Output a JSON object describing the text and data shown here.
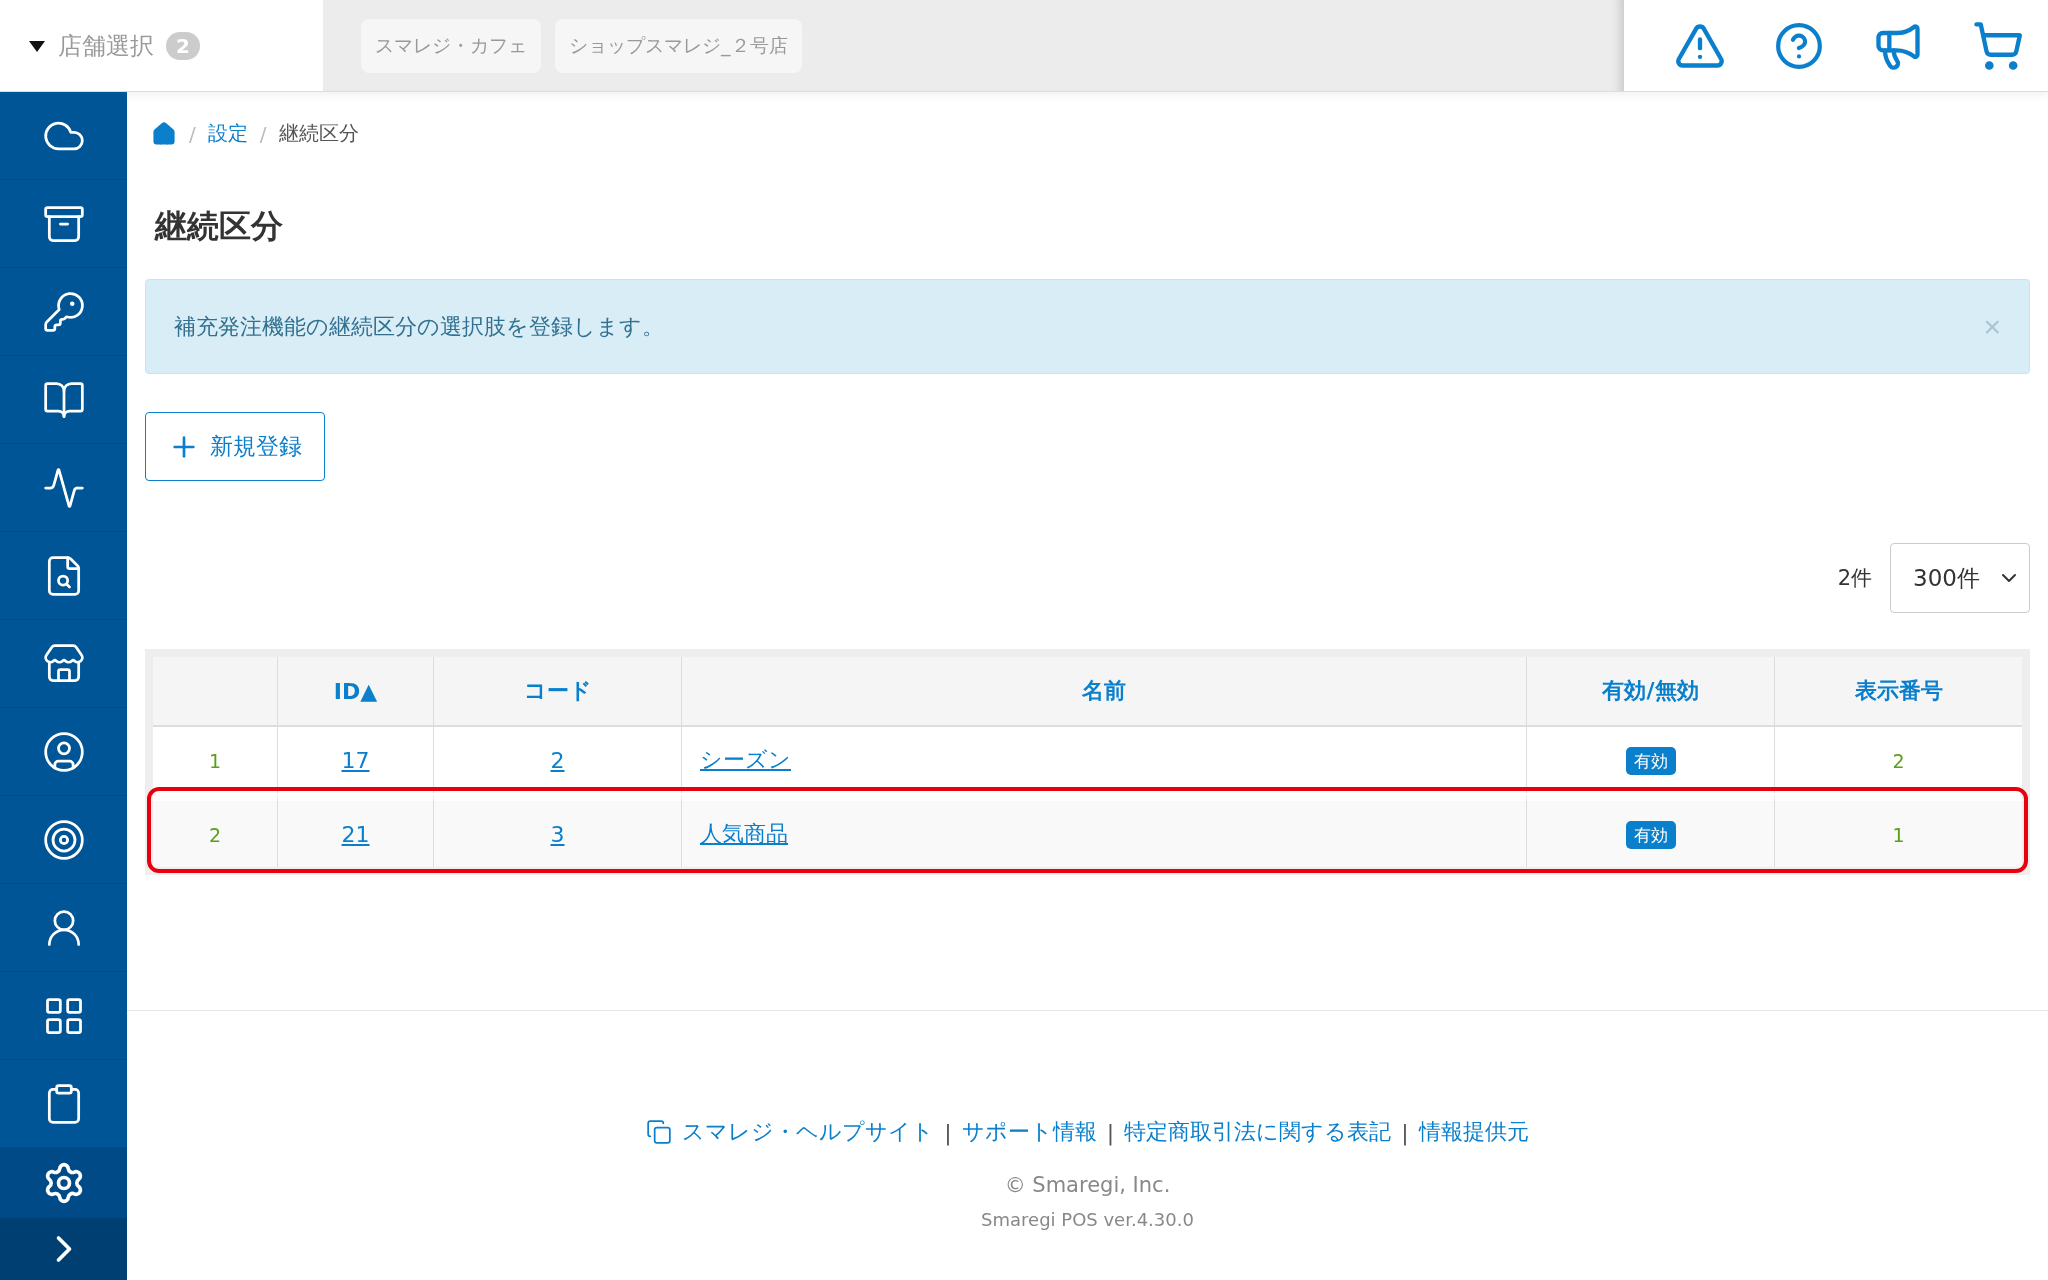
{
  "header": {
    "store_selector": {
      "label": "店舗選択",
      "count": "2",
      "expanded": true
    },
    "stores": [
      {
        "label": "スマレジ・カフェ"
      },
      {
        "label": "ショップスマレジ_２号店"
      }
    ]
  },
  "sidebar": {
    "items": [
      {
        "kind": "cloud"
      },
      {
        "kind": "archive"
      },
      {
        "kind": "key"
      },
      {
        "kind": "book"
      },
      {
        "kind": "chart"
      },
      {
        "kind": "report"
      },
      {
        "kind": "store"
      },
      {
        "kind": "staff"
      },
      {
        "kind": "target"
      },
      {
        "kind": "customer"
      },
      {
        "kind": "grid"
      },
      {
        "kind": "clipboard"
      }
    ],
    "bottom": [
      {
        "kind": "settings"
      },
      {
        "kind": "expand"
      }
    ]
  },
  "breadcrumb_separator": "/",
  "breadcrumb": [
    {
      "kind": "home"
    },
    {
      "kind": "link",
      "label": "設定"
    },
    {
      "kind": "current",
      "label": "継続区分"
    }
  ],
  "title": "継続区分",
  "alert": {
    "message": "補充発注機能の継続区分の選択肢を登録します。",
    "close": "×"
  },
  "new_button": "新規登録",
  "list": {
    "count": "2件",
    "page_size": "300件"
  },
  "table": {
    "columns": [
      "",
      "ID▲",
      "コード",
      "名前",
      "有効/無効",
      "表示番号"
    ],
    "rows": [
      {
        "no": "1",
        "id": "17",
        "code": "2",
        "name": "シーズン",
        "status": "有効",
        "order": "2",
        "highlighted": false
      },
      {
        "no": "2",
        "id": "21",
        "code": "3",
        "name": "人気商品",
        "status": "有効",
        "order": "1",
        "highlighted": true
      }
    ]
  },
  "footer": {
    "links": [
      "スマレジ・ヘルプサイト",
      "サポート情報",
      "特定商取引法に関する表記",
      "情報提供元"
    ],
    "separator": "|",
    "copyright": "© Smaregi, Inc.",
    "version": "Smaregi POS ver.4.30.0"
  }
}
